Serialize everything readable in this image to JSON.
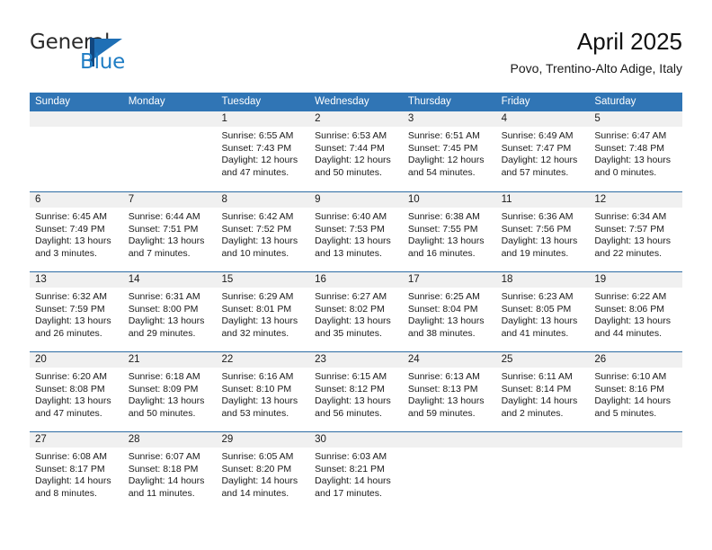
{
  "brand": {
    "name_part1": "General",
    "name_part2": "Blue",
    "mark": "triangle-logo-icon",
    "colors": {
      "dark_blue": "#12477f",
      "blue": "#1f6fb5",
      "text_blue": "#1f7dc4"
    }
  },
  "header": {
    "title": "April 2025",
    "subtitle": "Povo, Trentino-Alto Adige, Italy"
  },
  "theme": {
    "header_blue": "#3075b5",
    "row_divider_blue": "#2e6da4",
    "day_number_band": "#f0f0f0"
  },
  "calendar": {
    "day_headers": [
      "Sunday",
      "Monday",
      "Tuesday",
      "Wednesday",
      "Thursday",
      "Friday",
      "Saturday"
    ],
    "weeks": [
      [
        {
          "day": "",
          "lines": []
        },
        {
          "day": "",
          "lines": []
        },
        {
          "day": "1",
          "lines": [
            "Sunrise: 6:55 AM",
            "Sunset: 7:43 PM",
            "Daylight: 12 hours",
            "and 47 minutes."
          ]
        },
        {
          "day": "2",
          "lines": [
            "Sunrise: 6:53 AM",
            "Sunset: 7:44 PM",
            "Daylight: 12 hours",
            "and 50 minutes."
          ]
        },
        {
          "day": "3",
          "lines": [
            "Sunrise: 6:51 AM",
            "Sunset: 7:45 PM",
            "Daylight: 12 hours",
            "and 54 minutes."
          ]
        },
        {
          "day": "4",
          "lines": [
            "Sunrise: 6:49 AM",
            "Sunset: 7:47 PM",
            "Daylight: 12 hours",
            "and 57 minutes."
          ]
        },
        {
          "day": "5",
          "lines": [
            "Sunrise: 6:47 AM",
            "Sunset: 7:48 PM",
            "Daylight: 13 hours",
            "and 0 minutes."
          ]
        }
      ],
      [
        {
          "day": "6",
          "lines": [
            "Sunrise: 6:45 AM",
            "Sunset: 7:49 PM",
            "Daylight: 13 hours",
            "and 3 minutes."
          ]
        },
        {
          "day": "7",
          "lines": [
            "Sunrise: 6:44 AM",
            "Sunset: 7:51 PM",
            "Daylight: 13 hours",
            "and 7 minutes."
          ]
        },
        {
          "day": "8",
          "lines": [
            "Sunrise: 6:42 AM",
            "Sunset: 7:52 PM",
            "Daylight: 13 hours",
            "and 10 minutes."
          ]
        },
        {
          "day": "9",
          "lines": [
            "Sunrise: 6:40 AM",
            "Sunset: 7:53 PM",
            "Daylight: 13 hours",
            "and 13 minutes."
          ]
        },
        {
          "day": "10",
          "lines": [
            "Sunrise: 6:38 AM",
            "Sunset: 7:55 PM",
            "Daylight: 13 hours",
            "and 16 minutes."
          ]
        },
        {
          "day": "11",
          "lines": [
            "Sunrise: 6:36 AM",
            "Sunset: 7:56 PM",
            "Daylight: 13 hours",
            "and 19 minutes."
          ]
        },
        {
          "day": "12",
          "lines": [
            "Sunrise: 6:34 AM",
            "Sunset: 7:57 PM",
            "Daylight: 13 hours",
            "and 22 minutes."
          ]
        }
      ],
      [
        {
          "day": "13",
          "lines": [
            "Sunrise: 6:32 AM",
            "Sunset: 7:59 PM",
            "Daylight: 13 hours",
            "and 26 minutes."
          ]
        },
        {
          "day": "14",
          "lines": [
            "Sunrise: 6:31 AM",
            "Sunset: 8:00 PM",
            "Daylight: 13 hours",
            "and 29 minutes."
          ]
        },
        {
          "day": "15",
          "lines": [
            "Sunrise: 6:29 AM",
            "Sunset: 8:01 PM",
            "Daylight: 13 hours",
            "and 32 minutes."
          ]
        },
        {
          "day": "16",
          "lines": [
            "Sunrise: 6:27 AM",
            "Sunset: 8:02 PM",
            "Daylight: 13 hours",
            "and 35 minutes."
          ]
        },
        {
          "day": "17",
          "lines": [
            "Sunrise: 6:25 AM",
            "Sunset: 8:04 PM",
            "Daylight: 13 hours",
            "and 38 minutes."
          ]
        },
        {
          "day": "18",
          "lines": [
            "Sunrise: 6:23 AM",
            "Sunset: 8:05 PM",
            "Daylight: 13 hours",
            "and 41 minutes."
          ]
        },
        {
          "day": "19",
          "lines": [
            "Sunrise: 6:22 AM",
            "Sunset: 8:06 PM",
            "Daylight: 13 hours",
            "and 44 minutes."
          ]
        }
      ],
      [
        {
          "day": "20",
          "lines": [
            "Sunrise: 6:20 AM",
            "Sunset: 8:08 PM",
            "Daylight: 13 hours",
            "and 47 minutes."
          ]
        },
        {
          "day": "21",
          "lines": [
            "Sunrise: 6:18 AM",
            "Sunset: 8:09 PM",
            "Daylight: 13 hours",
            "and 50 minutes."
          ]
        },
        {
          "day": "22",
          "lines": [
            "Sunrise: 6:16 AM",
            "Sunset: 8:10 PM",
            "Daylight: 13 hours",
            "and 53 minutes."
          ]
        },
        {
          "day": "23",
          "lines": [
            "Sunrise: 6:15 AM",
            "Sunset: 8:12 PM",
            "Daylight: 13 hours",
            "and 56 minutes."
          ]
        },
        {
          "day": "24",
          "lines": [
            "Sunrise: 6:13 AM",
            "Sunset: 8:13 PM",
            "Daylight: 13 hours",
            "and 59 minutes."
          ]
        },
        {
          "day": "25",
          "lines": [
            "Sunrise: 6:11 AM",
            "Sunset: 8:14 PM",
            "Daylight: 14 hours",
            "and 2 minutes."
          ]
        },
        {
          "day": "26",
          "lines": [
            "Sunrise: 6:10 AM",
            "Sunset: 8:16 PM",
            "Daylight: 14 hours",
            "and 5 minutes."
          ]
        }
      ],
      [
        {
          "day": "27",
          "lines": [
            "Sunrise: 6:08 AM",
            "Sunset: 8:17 PM",
            "Daylight: 14 hours",
            "and 8 minutes."
          ]
        },
        {
          "day": "28",
          "lines": [
            "Sunrise: 6:07 AM",
            "Sunset: 8:18 PM",
            "Daylight: 14 hours",
            "and 11 minutes."
          ]
        },
        {
          "day": "29",
          "lines": [
            "Sunrise: 6:05 AM",
            "Sunset: 8:20 PM",
            "Daylight: 14 hours",
            "and 14 minutes."
          ]
        },
        {
          "day": "30",
          "lines": [
            "Sunrise: 6:03 AM",
            "Sunset: 8:21 PM",
            "Daylight: 14 hours",
            "and 17 minutes."
          ]
        },
        {
          "day": "",
          "lines": []
        },
        {
          "day": "",
          "lines": []
        },
        {
          "day": "",
          "lines": []
        }
      ]
    ]
  }
}
